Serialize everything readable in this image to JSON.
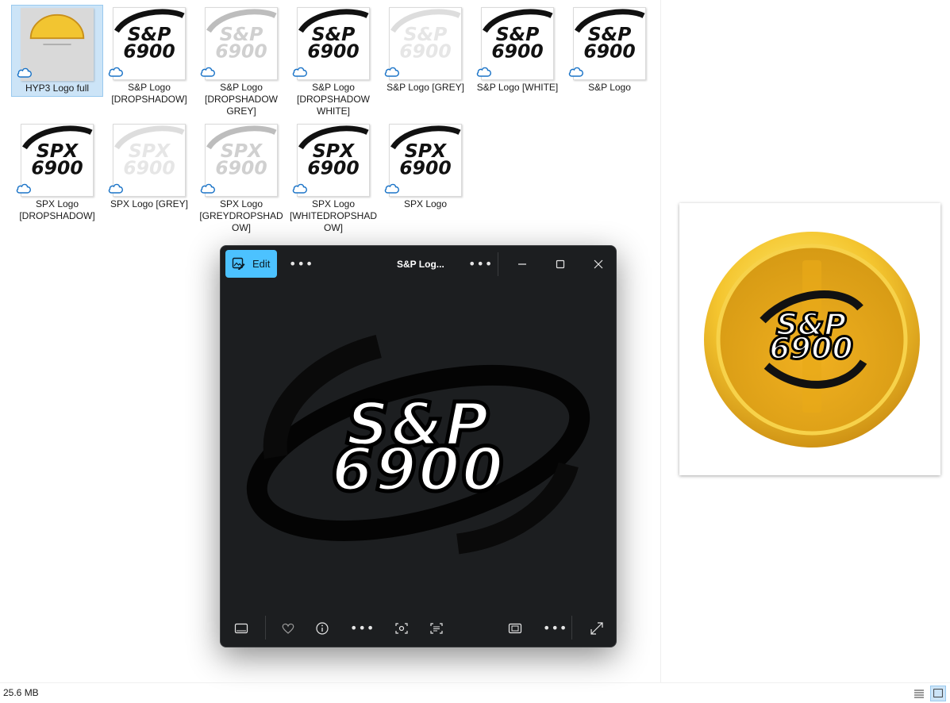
{
  "files": [
    {
      "name": "HYP3 Logo full",
      "thumb": "gold-coin",
      "selected": true
    },
    {
      "name": "S&P Logo [DROPSHADOW]",
      "thumb": "snp-black",
      "selected": false
    },
    {
      "name": "S&P Logo [DROPSHADOW GREY]",
      "thumb": "snp-grey",
      "selected": false
    },
    {
      "name": "S&P Logo [DROPSHADOW WHITE]",
      "thumb": "snp-black",
      "selected": false
    },
    {
      "name": "S&P Logo [GREY]",
      "thumb": "snp-lightgrey",
      "selected": false
    },
    {
      "name": "S&P Logo [WHITE]",
      "thumb": "snp-black",
      "selected": false
    },
    {
      "name": "S&P Logo",
      "thumb": "snp-black",
      "selected": false
    },
    {
      "name": "SPX Logo [DROPSHADOW]",
      "thumb": "spx-black",
      "selected": false
    },
    {
      "name": "SPX Logo [GREY]",
      "thumb": "spx-lightgrey",
      "selected": false
    },
    {
      "name": "SPX Logo [GREYDROPSHADOW]",
      "thumb": "spx-grey",
      "selected": false
    },
    {
      "name": "SPX Logo [WHITEDROPSHADOW]",
      "thumb": "spx-black",
      "selected": false
    },
    {
      "name": "SPX Logo",
      "thumb": "spx-black",
      "selected": false
    }
  ],
  "viewer": {
    "edit_label": "Edit",
    "title": "S&P Log...",
    "image_text_line1": "S&P",
    "image_text_line2": "6900"
  },
  "preview": {
    "image_text_line1": "S&P",
    "image_text_line2": "6900"
  },
  "status": {
    "size": "25.6 MB"
  },
  "colors": {
    "edit_accent": "#4cc2ff",
    "selection": "#cce4f7",
    "viewer_bg": "#1c1e20",
    "coin_gold": "#e8b32a"
  },
  "icons": {
    "cloud": "cloud-icon",
    "edit": "edit-image-icon",
    "more": "more-icon",
    "minimize": "minimize-icon",
    "maximize": "maximize-icon",
    "close": "close-icon",
    "filmstrip": "filmstrip-icon",
    "favorite": "heart-icon",
    "info": "info-icon",
    "visual_search": "visual-search-icon",
    "ocr": "text-scan-icon",
    "slideshow": "slideshow-icon",
    "fullscreen": "fullscreen-icon",
    "details_view": "details-view-icon",
    "large_icons_view": "large-icons-view-icon"
  }
}
